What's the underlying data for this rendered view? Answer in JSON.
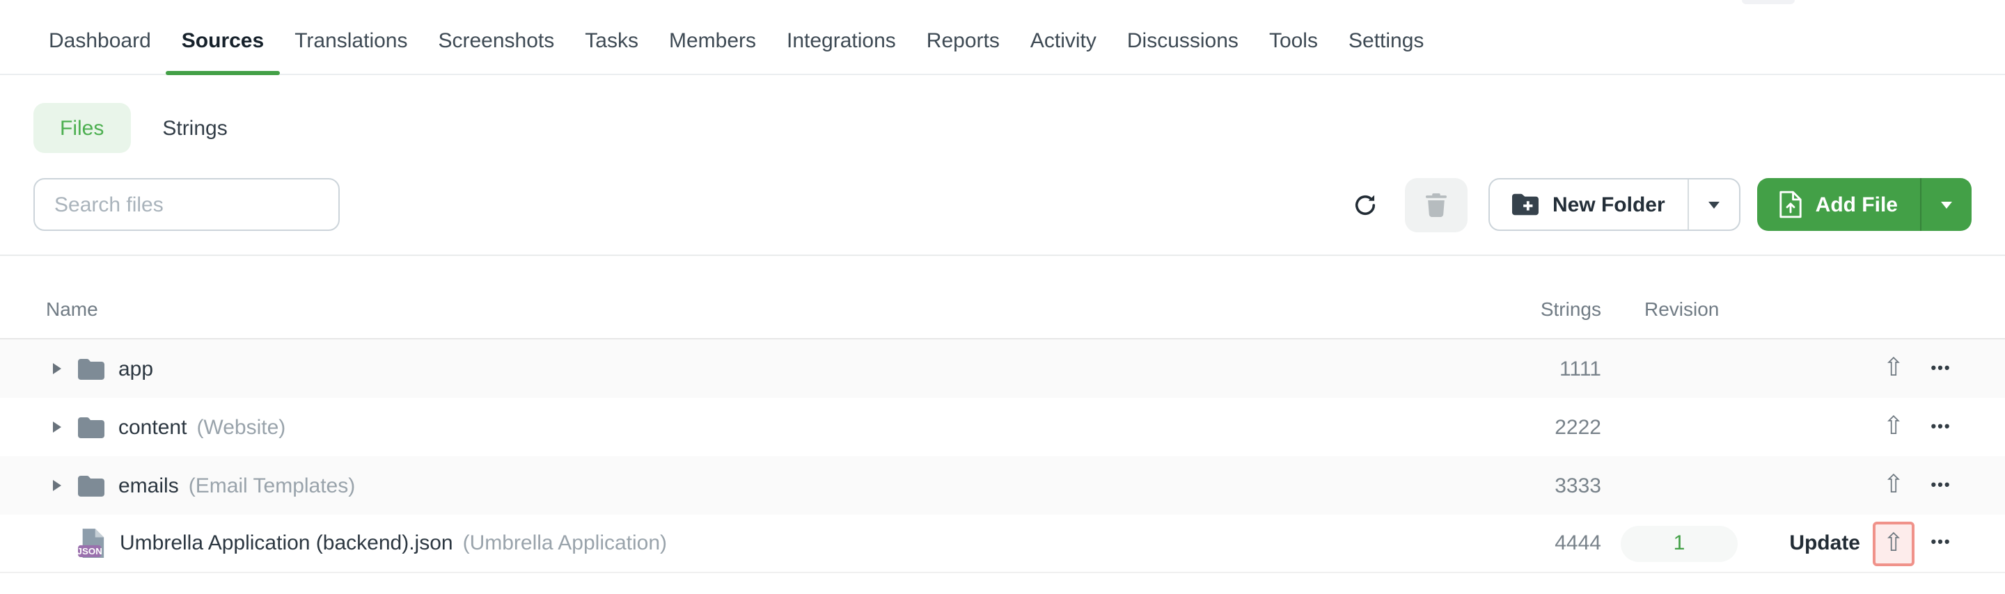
{
  "nav": {
    "items": [
      {
        "label": "Dashboard",
        "active": false
      },
      {
        "label": "Sources",
        "active": true
      },
      {
        "label": "Translations",
        "active": false
      },
      {
        "label": "Screenshots",
        "active": false
      },
      {
        "label": "Tasks",
        "active": false
      },
      {
        "label": "Members",
        "active": false
      },
      {
        "label": "Integrations",
        "active": false
      },
      {
        "label": "Reports",
        "active": false
      },
      {
        "label": "Activity",
        "active": false
      },
      {
        "label": "Discussions",
        "active": false
      },
      {
        "label": "Tools",
        "active": false
      },
      {
        "label": "Settings",
        "active": false
      }
    ]
  },
  "view_tabs": {
    "files_label": "Files",
    "strings_label": "Strings",
    "active": "Files"
  },
  "toolbar": {
    "search_placeholder": "Search files",
    "search_value": "",
    "new_folder_label": "New Folder",
    "add_file_label": "Add File"
  },
  "table": {
    "columns": {
      "name": "Name",
      "strings": "Strings",
      "revision": "Revision"
    },
    "rows": [
      {
        "type": "folder",
        "name": "app",
        "note": "",
        "strings": "1111",
        "revision": "",
        "update_label": "",
        "highlighted": false
      },
      {
        "type": "folder",
        "name": "content",
        "note": "(Website)",
        "strings": "2222",
        "revision": "",
        "update_label": "",
        "highlighted": false
      },
      {
        "type": "folder",
        "name": "emails",
        "note": "(Email Templates)",
        "strings": "3333",
        "revision": "",
        "update_label": "",
        "highlighted": false
      },
      {
        "type": "file",
        "name": "Umbrella Application (backend).json",
        "note": "(Umbrella Application)",
        "strings": "4444",
        "revision": "1",
        "update_label": "Update",
        "highlighted": true,
        "badge": "JSON"
      }
    ]
  },
  "icons": {
    "upload_glyph": "⇧",
    "more_glyph": "•••"
  },
  "colors": {
    "accent_green": "#43a047",
    "files_tab_bg": "#e9f5ea",
    "highlight_border": "#f0928a",
    "highlight_bg": "#fdeceb",
    "row_stripe": "#fafafa",
    "json_badge": "#9a70ad"
  }
}
